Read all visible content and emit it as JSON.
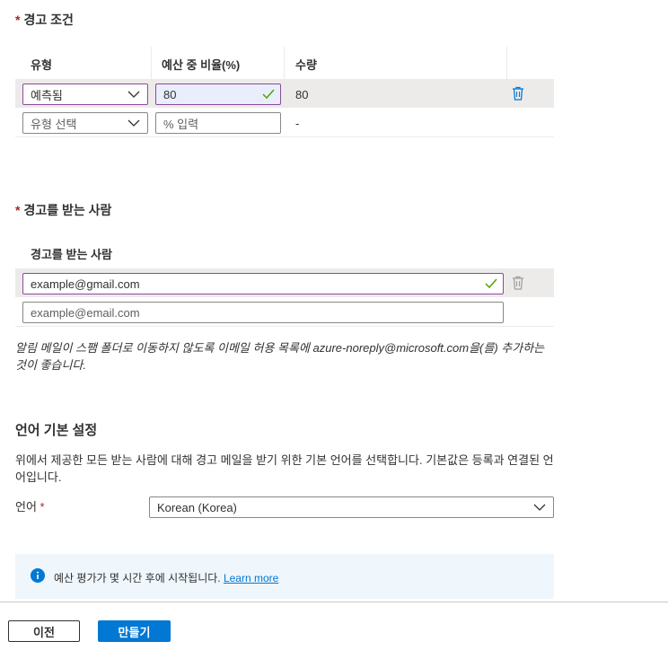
{
  "alert_conditions": {
    "title": "경고 조건",
    "required_mark": "*",
    "columns": [
      "유형",
      "예산 중 비율(%)",
      "수량"
    ],
    "rows": [
      {
        "type_value": "예측됨",
        "percent_value": "80",
        "amount": "80"
      },
      {
        "type_placeholder": "유형 선택",
        "percent_placeholder": "% 입력",
        "amount": "-"
      }
    ]
  },
  "recipients": {
    "title": "경고를 받는 사람",
    "required_mark": "*",
    "column_header": "경고를 받는 사람",
    "emails": [
      {
        "value": "example@gmail.com"
      },
      {
        "placeholder": "example@email.com"
      }
    ],
    "note": "알림 메일이 스팸 폴더로 이동하지 않도록 이메일 허용 목록에 azure-noreply@microsoft.com을(를) 추가하는 것이 좋습니다."
  },
  "language": {
    "title": "언어 기본 설정",
    "description": "위에서 제공한 모든 받는 사람에 대해 경고 메일을 받기 위한 기본 언어를 선택합니다. 기본값은 등록과 연결된 언어입니다.",
    "label": "언어",
    "required_mark": "*",
    "selected": "Korean (Korea)"
  },
  "info": {
    "text": "예산 평가가 몇 시간 후에 시작됩니다.",
    "link": "Learn more"
  },
  "footer": {
    "prev_label": "이전",
    "create_label": "만들기"
  },
  "colors": {
    "accent": "#0078d4",
    "required": "#a4262c",
    "active_border": "#8c4a9c",
    "valid_check": "#57a300"
  }
}
